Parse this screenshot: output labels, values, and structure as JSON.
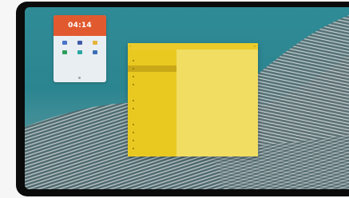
{
  "widget": {
    "time": "04:14",
    "date": "",
    "apps": [
      {
        "label": "",
        "color": "#4a72c9"
      },
      {
        "label": "",
        "color": "#3f5aa8"
      },
      {
        "label": "",
        "color": "#e5b43a"
      },
      {
        "label": "",
        "color": "#2e9e5b"
      },
      {
        "label": "",
        "color": "#2aa6a2"
      },
      {
        "label": "",
        "color": "#3a6fb6"
      }
    ],
    "footer_label": ""
  },
  "window": {
    "title": "",
    "sections": [
      {
        "heading": "",
        "items": [
          "",
          "",
          "",
          ""
        ]
      },
      {
        "heading": "",
        "items": [
          "",
          ""
        ]
      },
      {
        "heading": "",
        "items": [
          "",
          "",
          "",
          ""
        ]
      }
    ]
  }
}
